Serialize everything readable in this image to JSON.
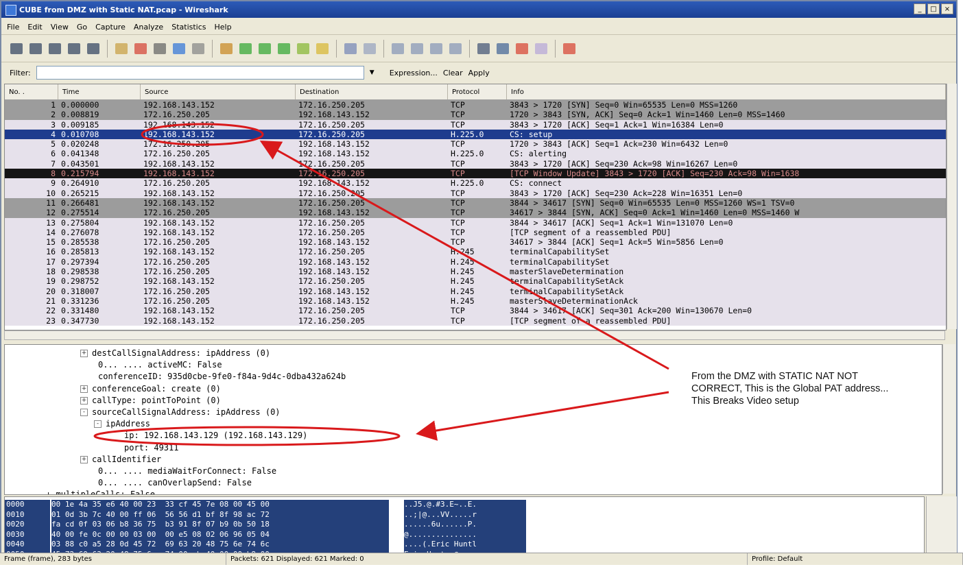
{
  "window": {
    "title": "CUBE from DMZ with Static NAT.pcap - Wireshark",
    "min": "_",
    "max": "□",
    "close": "×"
  },
  "menu": [
    "File",
    "Edit",
    "View",
    "Go",
    "Capture",
    "Analyze",
    "Statistics",
    "Help"
  ],
  "filter": {
    "label": "Filter:",
    "value": "",
    "expression": "Expression...",
    "clear": "Clear",
    "apply": "Apply"
  },
  "columns": [
    "No. .",
    "Time",
    "Source",
    "Destination",
    "Protocol",
    "Info"
  ],
  "packets": [
    {
      "no": "1",
      "time": "0.000000",
      "src": "192.168.143.152",
      "dst": "172.16.250.205",
      "proto": "TCP",
      "info": "3843 > 1720 [SYN] Seq=0 Win=65535 Len=0 MSS=1260",
      "style": "syn"
    },
    {
      "no": "2",
      "time": "0.008819",
      "src": "172.16.250.205",
      "dst": "192.168.143.152",
      "proto": "TCP",
      "info": "1720 > 3843 [SYN, ACK] Seq=0 Ack=1 Win=1460 Len=0 MSS=1460",
      "style": "syn"
    },
    {
      "no": "3",
      "time": "0.009185",
      "src": "192.168.143.152",
      "dst": "172.16.250.205",
      "proto": "TCP",
      "info": "3843 > 1720 [ACK] Seq=1 Ack=1 Win=16384 Len=0",
      "style": "tcp"
    },
    {
      "no": "4",
      "time": "0.010708",
      "src": "192.168.143.152",
      "dst": "172.16.250.205",
      "proto": "H.225.0",
      "info": "CS: setup",
      "style": "sel"
    },
    {
      "no": "5",
      "time": "0.020248",
      "src": "172.16.250.205",
      "dst": "192.168.143.152",
      "proto": "TCP",
      "info": "1720 > 3843 [ACK] Seq=1 Ack=230 Win=6432 Len=0",
      "style": "tcp"
    },
    {
      "no": "6",
      "time": "0.041348",
      "src": "172.16.250.205",
      "dst": "192.168.143.152",
      "proto": "H.225.0",
      "info": "CS: alerting",
      "style": "h225"
    },
    {
      "no": "7",
      "time": "0.043501",
      "src": "192.168.143.152",
      "dst": "172.16.250.205",
      "proto": "TCP",
      "info": "3843 > 1720 [ACK] Seq=230 Ack=98 Win=16267 Len=0",
      "style": "tcp"
    },
    {
      "no": "8",
      "time": "0.215794",
      "src": "192.168.143.152",
      "dst": "172.16.250.205",
      "proto": "TCP",
      "info": "[TCP Window Update] 3843 > 1720 [ACK] Seq=230 Ack=98 Win=1638",
      "style": "bad"
    },
    {
      "no": "9",
      "time": "0.264910",
      "src": "172.16.250.205",
      "dst": "192.168.143.152",
      "proto": "H.225.0",
      "info": "CS: connect",
      "style": "h225"
    },
    {
      "no": "10",
      "time": "0.265215",
      "src": "192.168.143.152",
      "dst": "172.16.250.205",
      "proto": "TCP",
      "info": "3843 > 1720 [ACK] Seq=230 Ack=228 Win=16351 Len=0",
      "style": "tcp"
    },
    {
      "no": "11",
      "time": "0.266481",
      "src": "192.168.143.152",
      "dst": "172.16.250.205",
      "proto": "TCP",
      "info": "3844 > 34617 [SYN] Seq=0 Win=65535 Len=0 MSS=1260 WS=1 TSV=0",
      "style": "syn"
    },
    {
      "no": "12",
      "time": "0.275514",
      "src": "172.16.250.205",
      "dst": "192.168.143.152",
      "proto": "TCP",
      "info": "34617 > 3844 [SYN, ACK] Seq=0 Ack=1 Win=1460 Len=0 MSS=1460 W",
      "style": "syn"
    },
    {
      "no": "13",
      "time": "0.275804",
      "src": "192.168.143.152",
      "dst": "172.16.250.205",
      "proto": "TCP",
      "info": "3844 > 34617 [ACK] Seq=1 Ack=1 Win=131070 Len=0",
      "style": "tcp"
    },
    {
      "no": "14",
      "time": "0.276078",
      "src": "192.168.143.152",
      "dst": "172.16.250.205",
      "proto": "TCP",
      "info": "[TCP segment of a reassembled PDU]",
      "style": "tcp"
    },
    {
      "no": "15",
      "time": "0.285538",
      "src": "172.16.250.205",
      "dst": "192.168.143.152",
      "proto": "TCP",
      "info": "34617 > 3844 [ACK] Seq=1 Ack=5 Win=5856 Len=0",
      "style": "tcp"
    },
    {
      "no": "16",
      "time": "0.285813",
      "src": "192.168.143.152",
      "dst": "172.16.250.205",
      "proto": "H.245",
      "info": "terminalCapabilitySet",
      "style": "h225"
    },
    {
      "no": "17",
      "time": "0.297394",
      "src": "172.16.250.205",
      "dst": "192.168.143.152",
      "proto": "H.245",
      "info": "terminalCapabilitySet",
      "style": "h225"
    },
    {
      "no": "18",
      "time": "0.298538",
      "src": "172.16.250.205",
      "dst": "192.168.143.152",
      "proto": "H.245",
      "info": "masterSlaveDetermination",
      "style": "h225"
    },
    {
      "no": "19",
      "time": "0.298752",
      "src": "192.168.143.152",
      "dst": "172.16.250.205",
      "proto": "H.245",
      "info": "terminalCapabilitySetAck",
      "style": "h225"
    },
    {
      "no": "20",
      "time": "0.318007",
      "src": "172.16.250.205",
      "dst": "192.168.143.152",
      "proto": "H.245",
      "info": "terminalCapabilitySetAck",
      "style": "h225"
    },
    {
      "no": "21",
      "time": "0.331236",
      "src": "172.16.250.205",
      "dst": "192.168.143.152",
      "proto": "H.245",
      "info": "masterSlaveDeterminationAck",
      "style": "h225"
    },
    {
      "no": "22",
      "time": "0.331480",
      "src": "192.168.143.152",
      "dst": "172.16.250.205",
      "proto": "TCP",
      "info": "3844 > 34617 [ACK] Seq=301 Ack=200 Win=130670 Len=0",
      "style": "tcp"
    },
    {
      "no": "23",
      "time": "0.347730",
      "src": "192.168.143.152",
      "dst": "172.16.250.205",
      "proto": "TCP",
      "info": "[TCP segment of a reassembled PDU]",
      "style": "tcp"
    }
  ],
  "details": [
    {
      "indent": 110,
      "exp": "+",
      "text": "destCallSignalAddress: ipAddress (0)"
    },
    {
      "indent": 136,
      "exp": "",
      "text": "0... .... activeMC: False"
    },
    {
      "indent": 136,
      "exp": "",
      "text": "conferenceID: 935d0cbe-9fe0-f84a-9d4c-0dba432a624b"
    },
    {
      "indent": 110,
      "exp": "+",
      "text": "conferenceGoal: create (0)"
    },
    {
      "indent": 110,
      "exp": "+",
      "text": "callType: pointToPoint (0)"
    },
    {
      "indent": 110,
      "exp": "-",
      "text": "sourceCallSignalAddress: ipAddress (0)"
    },
    {
      "indent": 130,
      "exp": "-",
      "text": "ipAddress"
    },
    {
      "indent": 174,
      "exp": "",
      "text": "ip: 192.168.143.129 (192.168.143.129)"
    },
    {
      "indent": 174,
      "exp": "",
      "text": "port: 49311"
    },
    {
      "indent": 110,
      "exp": "+",
      "text": "callIdentifier"
    },
    {
      "indent": 136,
      "exp": "",
      "text": "0... .... mediaWaitForConnect: False"
    },
    {
      "indent": 136,
      "exp": "",
      "text": "0... .... canOverlapSend: False"
    },
    {
      "indent": 60,
      "exp": "",
      "text": "+ multipleCalls: False"
    }
  ],
  "hex": {
    "offsets": "0000\n0010\n0020\n0030\n0040\n0050",
    "bytes": "00 1e 4a 35 e6 40 00 23  33 cf 45 7e 08 00 45 00\n01 0d 3b 7c 40 00 ff 06  56 56 d1 bf 8f 98 ac 72\nfa cd 0f 03 06 b8 36 75  b3 91 8f 07 b9 0b 50 18\n40 00 fe 0c 00 00 03 00  00 e5 08 02 06 96 05 04\n03 88 c0 a5 28 0d 45 72  69 63 20 48 75 6e 74 6c\n45 72 69 63 20 48 75 6e  74 00 ab 40 00 00 b8 00",
    "ascii": "..J5.@.#3.E~..E.\n..;|@...VV.....r\n......6u......P.\n@...............\n....(.Eric Huntl\nEric Hunt..@...."
  },
  "status": {
    "frame": "Frame (frame), 283 bytes",
    "packets": "Packets: 621 Displayed: 621 Marked: 0",
    "profile": "Profile: Default"
  },
  "annotation": "From the DMZ with STATIC NAT NOT CORRECT, This is the Global PAT address... This Breaks Video setup",
  "colors": {
    "selected": "#1e3c8e",
    "annotation": "#d9191b"
  },
  "toolbar_icons": [
    "interfaces-icon",
    "options-icon",
    "start-icon",
    "stop-icon",
    "restart-icon",
    "open-icon",
    "save-icon",
    "close-file-icon",
    "reload-icon",
    "print-icon",
    "find-icon",
    "back-icon",
    "forward-icon",
    "goto-icon",
    "first-icon",
    "last-icon",
    "colorize-icon",
    "autoscroll-icon",
    "zoom-in-icon",
    "zoom-out-icon",
    "zoom-normal-icon",
    "resize-icon",
    "capture-filter-icon",
    "display-filter-icon",
    "coloring-rules-icon",
    "prefs-icon",
    "help-icon"
  ]
}
